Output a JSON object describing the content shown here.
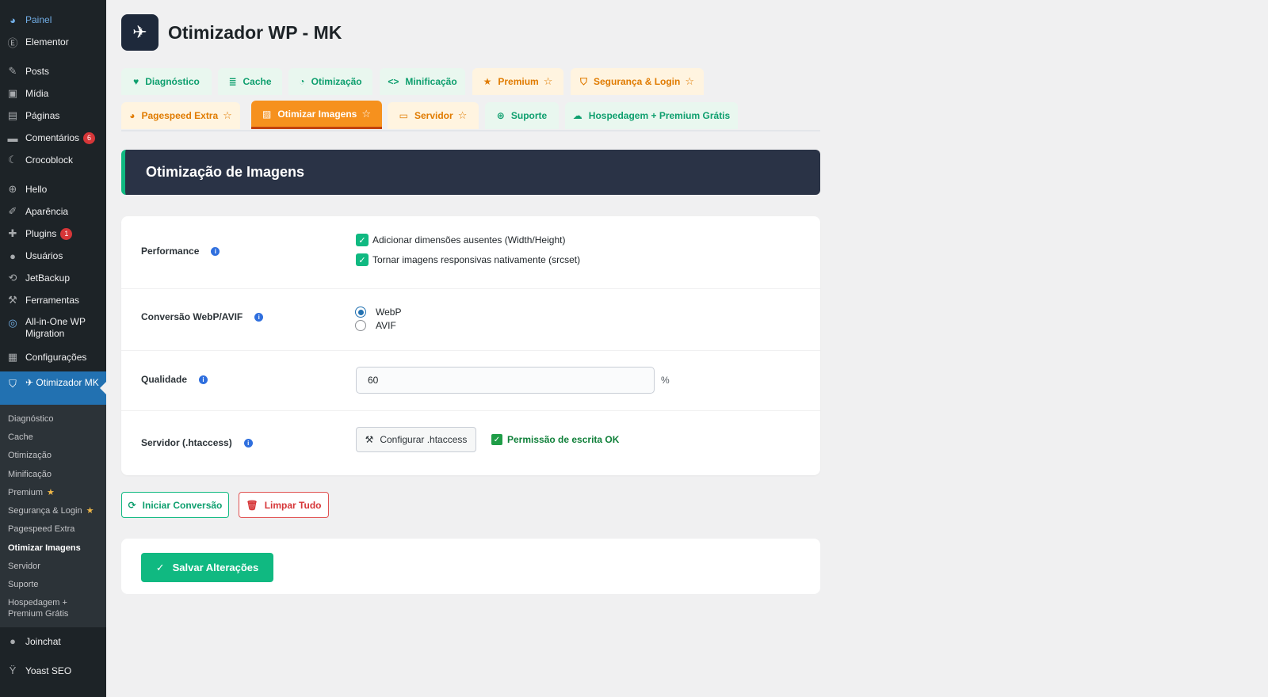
{
  "sidebar": {
    "items": [
      {
        "label": "Painel",
        "icon": "dashboard-icon"
      },
      {
        "label": "Elementor",
        "icon": "elementor-icon"
      },
      {
        "label": "Posts",
        "icon": "pin-icon"
      },
      {
        "label": "Mídia",
        "icon": "media-icon"
      },
      {
        "label": "Páginas",
        "icon": "page-icon"
      },
      {
        "label": "Comentários",
        "icon": "comment-icon",
        "badge": "6"
      },
      {
        "label": "Crocoblock",
        "icon": "crocoblock-icon"
      },
      {
        "label": "Hello",
        "icon": "plus-circle-icon"
      },
      {
        "label": "Aparência",
        "icon": "brush-icon"
      },
      {
        "label": "Plugins",
        "icon": "plugin-icon",
        "badge": "1"
      },
      {
        "label": "Usuários",
        "icon": "user-icon"
      },
      {
        "label": "JetBackup",
        "icon": "backup-icon"
      },
      {
        "label": "Ferramentas",
        "icon": "wrench-icon"
      },
      {
        "label": "All-in-One WP Migration",
        "icon": "migration-icon"
      },
      {
        "label": "Configurações",
        "icon": "settings-icon"
      },
      {
        "label": "Otimizador MK",
        "icon": "rocket-icon"
      },
      {
        "label": "Joinchat",
        "icon": "chat-icon"
      },
      {
        "label": "Yoast SEO",
        "icon": "yoast-icon"
      }
    ],
    "submenu": [
      {
        "label": "Diagnóstico"
      },
      {
        "label": "Cache"
      },
      {
        "label": "Otimização"
      },
      {
        "label": "Minificação"
      },
      {
        "label": "Premium",
        "star": "★"
      },
      {
        "label": "Segurança & Login",
        "star": "★"
      },
      {
        "label": "Pagespeed Extra"
      },
      {
        "label": "Otimizar Imagens"
      },
      {
        "label": "Servidor"
      },
      {
        "label": "Suporte"
      },
      {
        "label": "Hospedagem + Premium Grátis"
      }
    ]
  },
  "header": {
    "title": "Otimizador WP - MK"
  },
  "tabs": [
    {
      "label": "Diagnóstico",
      "icon": "heart-icon"
    },
    {
      "label": "Cache",
      "icon": "database-icon"
    },
    {
      "label": "Otimização",
      "icon": "gauge-icon"
    },
    {
      "label": "Minificação",
      "icon": "code-icon"
    },
    {
      "label": "Premium",
      "icon": "star-icon"
    },
    {
      "label": "Segurança & Login",
      "icon": "shield-icon"
    },
    {
      "label": "Pagespeed Extra",
      "icon": "speedometer-icon"
    },
    {
      "label": "Otimizar Imagens",
      "icon": "images-icon"
    },
    {
      "label": "Servidor",
      "icon": "server-icon"
    },
    {
      "label": "Suporte",
      "icon": "lifering-icon"
    },
    {
      "label": "Hospedagem + Premium Grátis",
      "icon": "cloud-icon"
    }
  ],
  "section": {
    "title": "Otimização de Imagens"
  },
  "settings": {
    "performance": {
      "label": "Performance",
      "options": [
        "Adicionar dimensões ausentes (Width/Height)",
        "Tornar imagens responsivas nativamente (srcset)"
      ]
    },
    "conversion": {
      "label": "Conversão WebP/AVIF",
      "options": [
        "WebP",
        "AVIF"
      ],
      "selected": "WebP"
    },
    "quality": {
      "label": "Qualidade",
      "value": "60",
      "unit": "%"
    },
    "server": {
      "label": "Servidor (.htaccess)",
      "button": "Configurar .htaccess",
      "status": "Permissão de escrita OK"
    }
  },
  "actions": {
    "start": "Iniciar Conversão",
    "clear": "Limpar Tudo",
    "save": "Salvar Alterações"
  },
  "colors": {
    "accent_green": "#10b981",
    "active_tab": "#f6911e",
    "sidebar_bg": "#1d2327",
    "wp_blue": "#2271b1"
  }
}
